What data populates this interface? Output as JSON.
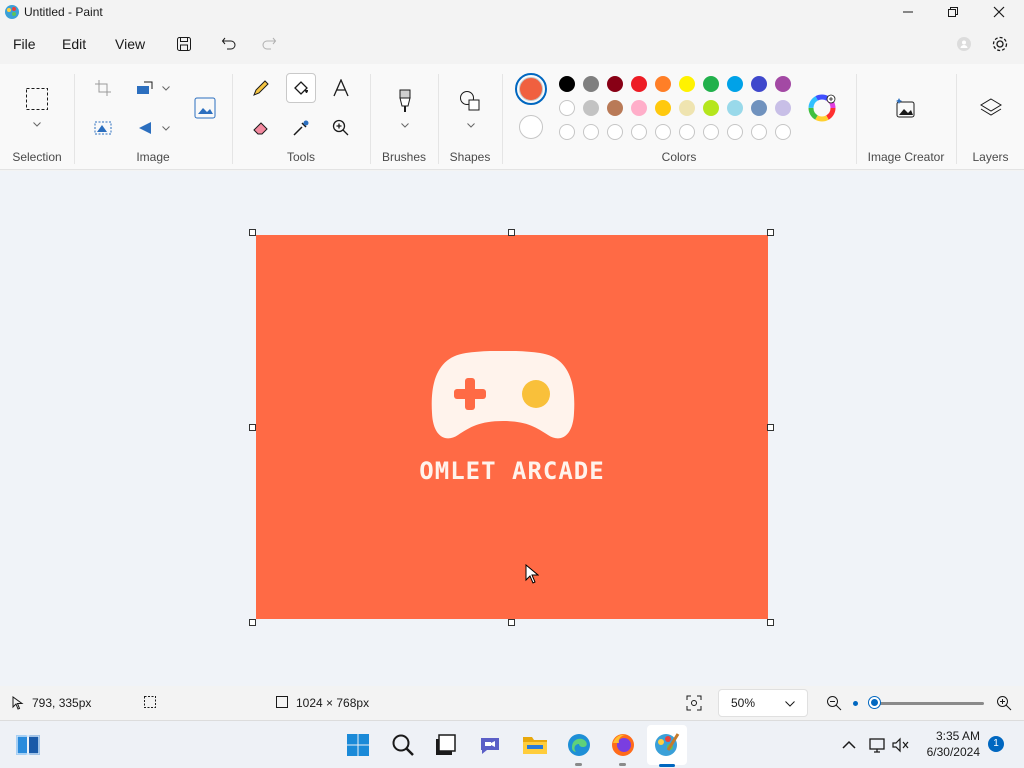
{
  "window": {
    "title": "Untitled - Paint"
  },
  "menu": {
    "file": "File",
    "edit": "Edit",
    "view": "View"
  },
  "ribbon": {
    "groups": {
      "selection": "Selection",
      "image": "Image",
      "tools": "Tools",
      "brushes": "Brushes",
      "shapes": "Shapes",
      "colors": "Colors",
      "image_creator": "Image Creator",
      "layers": "Layers"
    },
    "primary_color": "#f0603f",
    "secondary_color": "#ffffff",
    "palette_row1": [
      "#000000",
      "#7f7f7f",
      "#880015",
      "#ed1c24",
      "#ff7f27",
      "#fff200",
      "#22b14c",
      "#00a2e8",
      "#3f48cc",
      "#a349a4"
    ],
    "palette_row2": [
      "#ffffff",
      "#c3c3c3",
      "#b97a57",
      "#ffaec9",
      "#ffc90e",
      "#efe4b0",
      "#b5e61d",
      "#99d9ea",
      "#7092be",
      "#c8bfe7"
    ]
  },
  "canvas": {
    "background": "#ff6a45",
    "logo_text": "OMLET ARCADE"
  },
  "status": {
    "cursor_position": "793, 335px",
    "canvas_size": "1024 × 768px",
    "zoom": "50%",
    "zoom_level": 0.5
  },
  "taskbar": {
    "time": "3:35 AM",
    "date": "6/30/2024",
    "notification_count": "1"
  }
}
